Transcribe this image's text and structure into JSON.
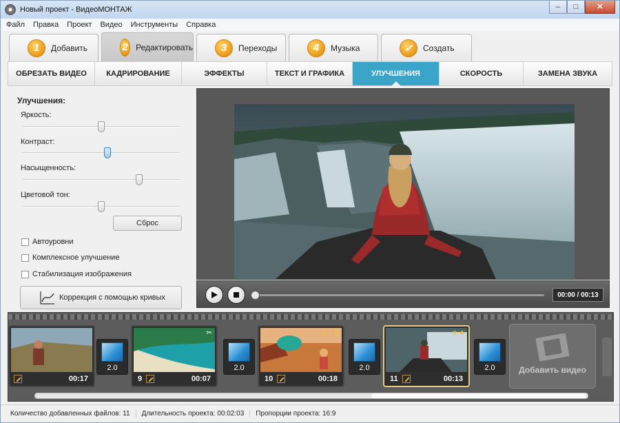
{
  "window": {
    "title": "Новый проект - ВидеоМОНТАЖ",
    "min": "–",
    "max": "□",
    "close": "✕"
  },
  "menu": [
    "Файл",
    "Правка",
    "Проект",
    "Видео",
    "Инструменты",
    "Справка"
  ],
  "steps": [
    {
      "num": "1",
      "label": "Добавить"
    },
    {
      "num": "2",
      "label": "Редактировать"
    },
    {
      "num": "3",
      "label": "Переходы"
    },
    {
      "num": "4",
      "label": "Музыка"
    },
    {
      "num": "✓",
      "label": "Создать"
    }
  ],
  "tabs": [
    "ОБРЕЗАТЬ ВИДЕО",
    "КАДРИРОВАНИЕ",
    "ЭФФЕКТЫ",
    "ТЕКСТ И ГРАФИКА",
    "УЛУЧШЕНИЯ",
    "СКОРОСТЬ",
    "ЗАМЕНА ЗВУКА"
  ],
  "active_tab": "УЛУЧШЕНИЯ",
  "enhance": {
    "title": "Улучшения:",
    "brightness": "Яркость:",
    "contrast": "Контраст:",
    "saturation": "Насыщенность:",
    "hue": "Цветовой тон:",
    "reset": "Сброс",
    "auto_levels": "Автоуровни",
    "complex": "Комплексное улучшение",
    "stabilize": "Стабилизация изображения",
    "curves": "Коррекция с помощью кривых",
    "levels": {
      "brightness": 0.5,
      "contrast": 0.54,
      "saturation": 0.74,
      "hue": 0.5
    }
  },
  "player": {
    "time": "00:00 / 00:13",
    "progress": 0.0
  },
  "timeline": {
    "clips": [
      {
        "num": "",
        "duration": "00:17"
      },
      {
        "num": "9",
        "duration": "00:07"
      },
      {
        "num": "10",
        "duration": "00:18"
      },
      {
        "num": "11",
        "duration": "00:13"
      }
    ],
    "transitions": [
      "2.0",
      "2.0",
      "2.0",
      "2.0"
    ],
    "add_video": "Добавить видео"
  },
  "status": {
    "files": "Количество добавленных файлов: 11",
    "duration": "Длительность проекта: 00:02:03",
    "aspect": "Пропорции проекта: 16:9"
  }
}
